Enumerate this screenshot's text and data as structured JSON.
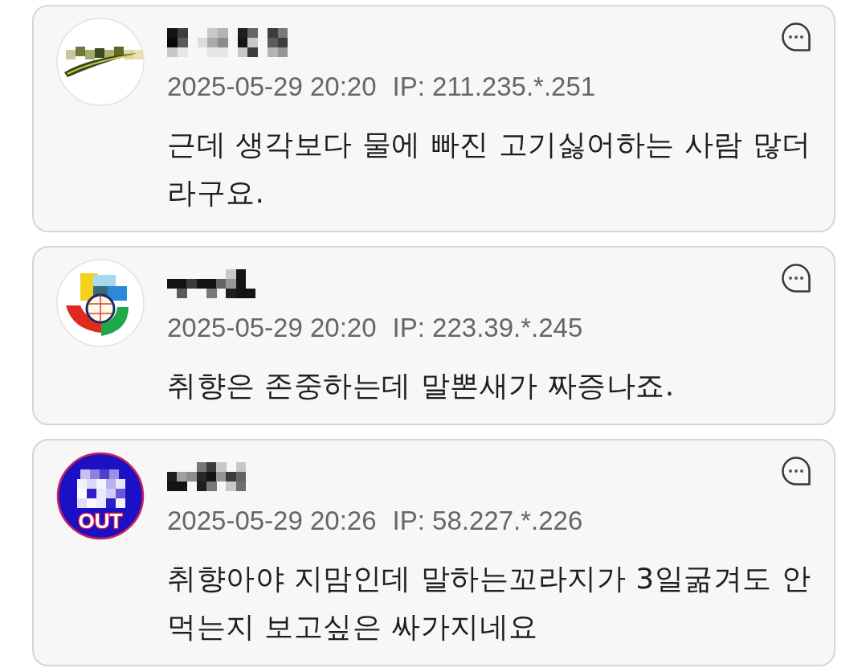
{
  "comments": [
    {
      "avatar": {
        "kind": "swoosh"
      },
      "time": "2025-05-29 20:20",
      "ip": "IP: 211.235.*.251",
      "text": "근데 생각보다 물에 빠진 고기싫어하는 사람 많더라구요."
    },
    {
      "avatar": {
        "kind": "globe"
      },
      "time": "2025-05-29 20:20",
      "ip": "IP: 223.39.*.245",
      "text": "취향은 존중하는데 말뽄새가 짜증나죠."
    },
    {
      "avatar": {
        "kind": "badge",
        "label": "OUT"
      },
      "time": "2025-05-29 20:26",
      "ip": "IP: 58.227.*.226",
      "text": "취향아야 지맘인데 말하는꼬라지가 3일굶겨도 안먹는지 보고싶은 싸가지네요"
    }
  ]
}
